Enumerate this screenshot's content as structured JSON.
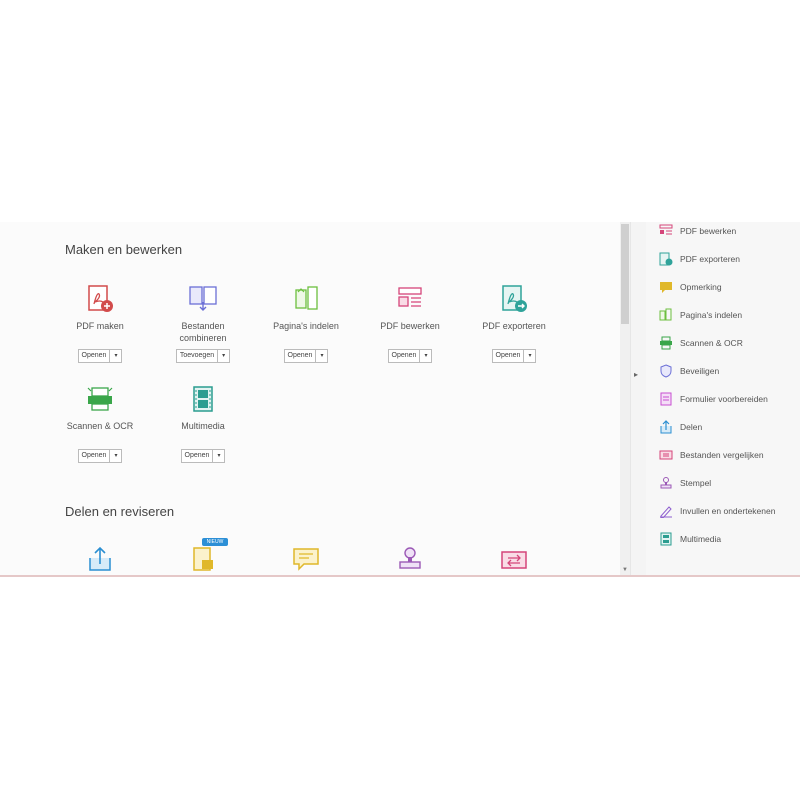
{
  "sections": {
    "make": {
      "title": "Maken en bewerken"
    },
    "share": {
      "title": "Delen en reviseren"
    }
  },
  "tools": [
    {
      "name": "pdf-maken",
      "label": "PDF maken",
      "action": "Openen",
      "icon": "pdf-create-icon",
      "color": "#d24b4b"
    },
    {
      "name": "bestanden-combineren",
      "label": "Bestanden combineren",
      "action": "Toevoegen",
      "icon": "combine-files-icon",
      "color": "#6b6fd6"
    },
    {
      "name": "paginas-indelen",
      "label": "Pagina's indelen",
      "action": "Openen",
      "icon": "organize-pages-icon",
      "color": "#6cbf3f"
    },
    {
      "name": "pdf-bewerken",
      "label": "PDF bewerken",
      "action": "Openen",
      "icon": "edit-pdf-icon",
      "color": "#d5457a"
    },
    {
      "name": "pdf-exporteren",
      "label": "PDF exporteren",
      "action": "Openen",
      "icon": "export-pdf-icon",
      "color": "#2fa39a"
    },
    {
      "name": "scannen-ocr",
      "label": "Scannen & OCR",
      "action": "Openen",
      "icon": "scan-icon",
      "color": "#3aa64a"
    },
    {
      "name": "multimedia",
      "label": "Multimedia",
      "action": "Openen",
      "icon": "film-icon",
      "color": "#2b9d90"
    }
  ],
  "share_tools": [
    {
      "name": "delen",
      "icon": "share-icon",
      "color": "#2b8fd2"
    },
    {
      "name": "verzenden-opmerkingen",
      "icon": "send-comments-icon",
      "color": "#e0b82a",
      "badge": "NIEUW"
    },
    {
      "name": "opmerking",
      "icon": "comment-icon",
      "color": "#e0b82a"
    },
    {
      "name": "stempel",
      "icon": "stamp-icon",
      "color": "#9b59b6"
    },
    {
      "name": "bestanden-vergelijken",
      "icon": "compare-icon",
      "color": "#d5457a"
    }
  ],
  "sidebar": {
    "items": [
      {
        "label": "PDF bewerken",
        "icon": "edit-pdf-icon",
        "color": "#d5457a"
      },
      {
        "label": "PDF exporteren",
        "icon": "export-pdf-icon",
        "color": "#2fa39a"
      },
      {
        "label": "Opmerking",
        "icon": "comment-icon",
        "color": "#e0b82a"
      },
      {
        "label": "Pagina's indelen",
        "icon": "organize-pages-icon",
        "color": "#6cbf3f"
      },
      {
        "label": "Scannen & OCR",
        "icon": "scan-icon",
        "color": "#3aa64a"
      },
      {
        "label": "Beveiligen",
        "icon": "shield-icon",
        "color": "#6b6fd6"
      },
      {
        "label": "Formulier voorbereiden",
        "icon": "form-icon",
        "color": "#c74fd0"
      },
      {
        "label": "Delen",
        "icon": "share-icon",
        "color": "#2b8fd2"
      },
      {
        "label": "Bestanden vergelijken",
        "icon": "compare-icon",
        "color": "#d5457a"
      },
      {
        "label": "Stempel",
        "icon": "stamp-icon",
        "color": "#9b59b6"
      },
      {
        "label": "Invullen en ondertekenen",
        "icon": "fill-sign-icon",
        "color": "#8e5fcf"
      },
      {
        "label": "Multimedia",
        "icon": "film-icon",
        "color": "#2b9d90"
      }
    ]
  }
}
